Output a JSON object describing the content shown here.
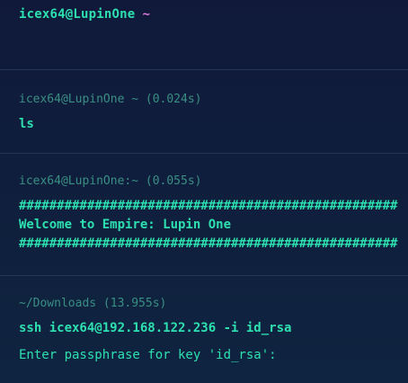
{
  "prompt": {
    "user_host": "icex64@LupinOne",
    "path": "~"
  },
  "blocks": [
    {
      "header": "icex64@LupinOne ~ (0.024s)",
      "command": "ls",
      "output": []
    },
    {
      "header": "icex64@LupinOne:~ (0.055s)",
      "command": "",
      "output": [
        "##################################################",
        "Welcome to Empire: Lupin One",
        "##################################################"
      ]
    },
    {
      "header": "~/Downloads (13.955s)",
      "command": "ssh icex64@192.168.122.236 -i id_rsa",
      "output": [
        "Enter passphrase for key 'id_rsa':"
      ]
    }
  ],
  "colors": {
    "background": "#0f1c3a",
    "text": "#2ee0b0",
    "dim_text": "#3a8f84",
    "tilde": "#e07be0",
    "divider": "#23365a"
  }
}
